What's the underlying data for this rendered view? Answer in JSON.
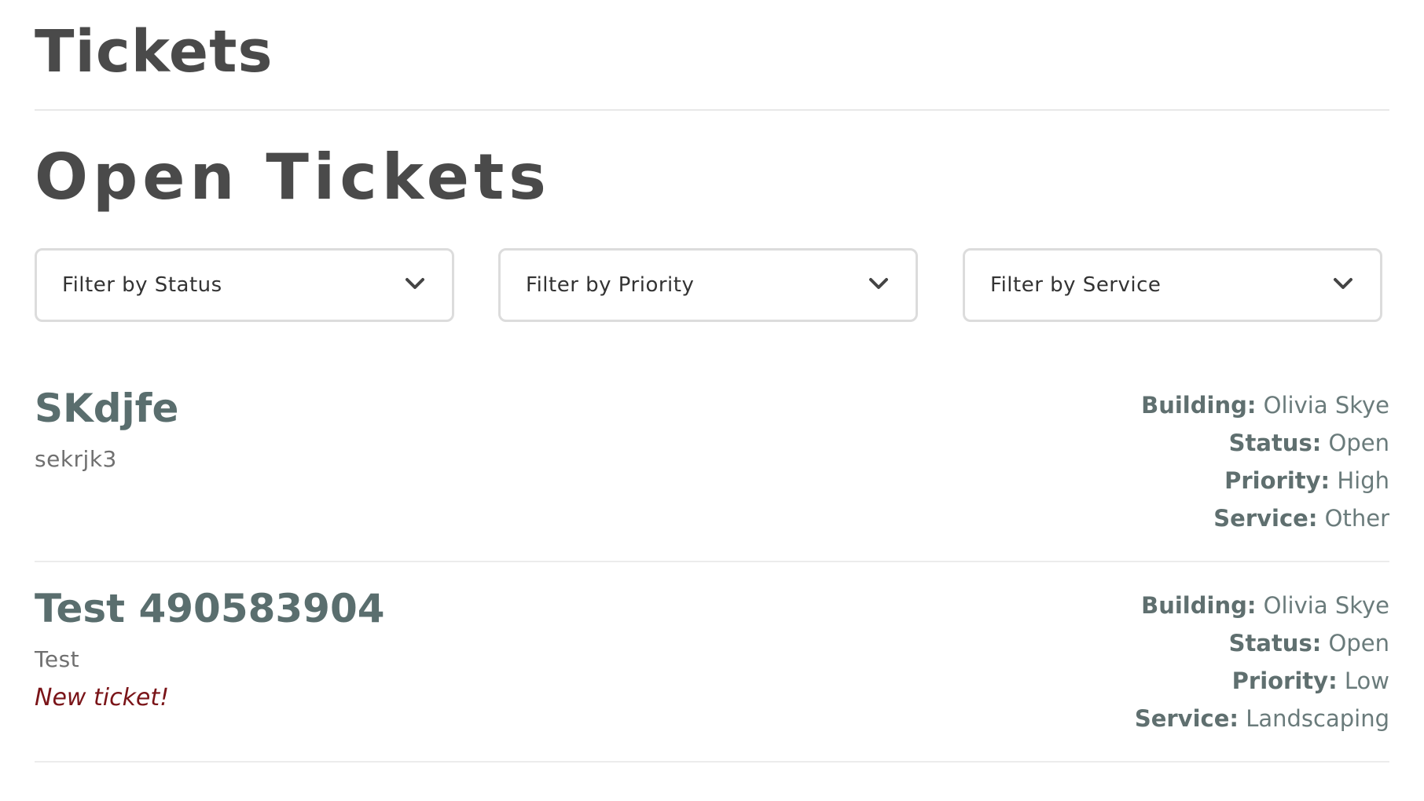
{
  "header": {
    "title": "Tickets"
  },
  "section": {
    "title": "Open Tickets"
  },
  "filters": [
    {
      "label": "Filter by Status",
      "icon": "chevron-down-icon"
    },
    {
      "label": "Filter by Priority",
      "icon": "chevron-down-icon"
    },
    {
      "label": "Filter by Service",
      "icon": "chevron-down-icon"
    }
  ],
  "meta_labels": {
    "building": "Building:",
    "status": "Status:",
    "priority": "Priority:",
    "service": "Service:"
  },
  "tickets": [
    {
      "title": "SKdjfe",
      "description": "sekrjk3",
      "note": "",
      "building": "Olivia Skye",
      "status": "Open",
      "priority": "High",
      "service": "Other"
    },
    {
      "title": "Test 490583904",
      "description": "Test",
      "note": "New ticket!",
      "building": "Olivia Skye",
      "status": "Open",
      "priority": "Low",
      "service": "Landscaping"
    }
  ],
  "colors": {
    "heading": "#4a4a4a",
    "ticket_title": "#5a6e6e",
    "new_ticket_note": "#7a1418",
    "border": "#dcdcdc"
  }
}
